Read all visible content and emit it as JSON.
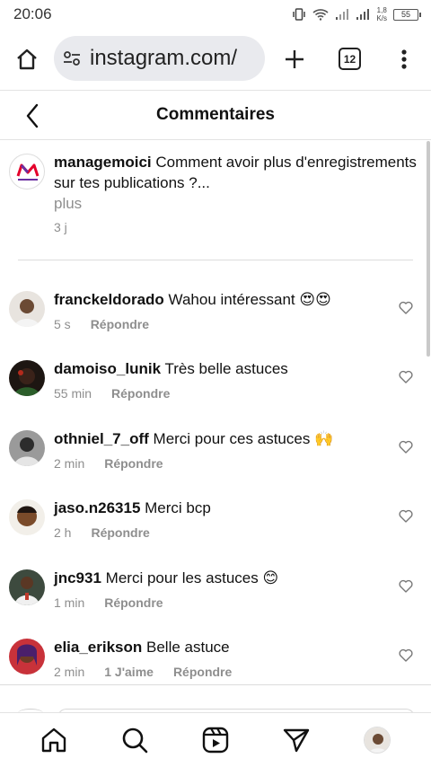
{
  "status_bar": {
    "time": "20:06",
    "net_speed_value": "1,8",
    "net_speed_unit": "K/s",
    "battery_level": "55",
    "icons": [
      "vibrate-icon",
      "wifi-icon",
      "signal-icon",
      "signal-icon",
      "battery-icon"
    ]
  },
  "browser": {
    "url": "instagram.com/",
    "tab_count": "12",
    "icons": [
      "home-icon",
      "site-settings-icon",
      "plus-icon",
      "tabs-icon",
      "more-vert-icon"
    ]
  },
  "header": {
    "title": "Commentaires",
    "back_icon": "chevron-left-icon"
  },
  "caption": {
    "username": "managemoici",
    "text": "Comment avoir plus d'enregistrements sur tes publications ?...",
    "more": "plus",
    "age": "3 j"
  },
  "comments": [
    {
      "username": "franckeldorado",
      "text": "Wahou intéressant 😍😍",
      "age": "5 s",
      "likes": "",
      "reply": "Répondre"
    },
    {
      "username": "damoiso_lunik",
      "text": "Très belle astuces",
      "age": "55 min",
      "likes": "",
      "reply": "Répondre"
    },
    {
      "username": "othniel_7_off",
      "text": "Merci pour ces astuces 🙌",
      "age": "2 min",
      "likes": "",
      "reply": "Répondre"
    },
    {
      "username": "jaso.n26315",
      "text": "Merci bcp",
      "age": "2 h",
      "likes": "",
      "reply": "Répondre"
    },
    {
      "username": "jnc931",
      "text": "Merci pour les astuces 😊",
      "age": "1 min",
      "likes": "",
      "reply": "Répondre"
    },
    {
      "username": "elia_erikson",
      "text": "Belle astuce",
      "age": "2 min",
      "likes": "1 J'aime",
      "reply": "Répondre"
    }
  ],
  "bottom_nav": {
    "items": [
      "home-icon",
      "search-icon",
      "reels-icon",
      "direct-icon",
      "profile-avatar"
    ]
  },
  "colors": {
    "accent_pill": "#e9eaee",
    "secondary_text": "#8e8e8e",
    "logo_red": "#e4002b",
    "logo_purple": "#6b2fa0"
  }
}
